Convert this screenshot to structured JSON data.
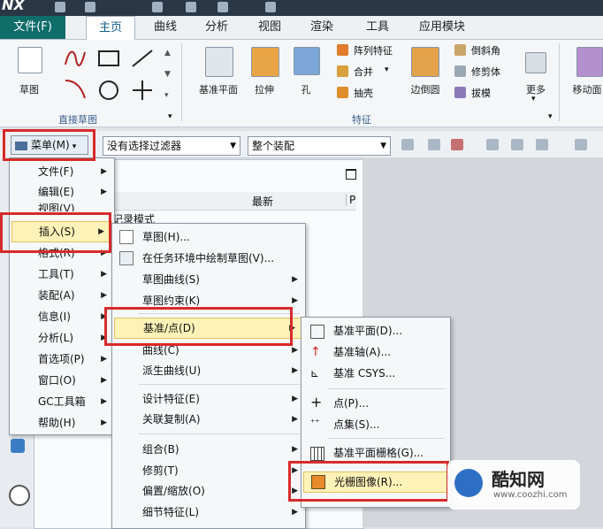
{
  "app": {
    "logo": "NX"
  },
  "tabs": [
    "文件(F)",
    "主页",
    "曲线",
    "分析",
    "视图",
    "渲染",
    "工具",
    "应用模块"
  ],
  "ribbon": {
    "sketch": "草图",
    "direct_sketch_group": "直接草图",
    "datum_plane": "基准平面",
    "extrude": "拉伸",
    "hole": "孔",
    "pattern_feature": "阵列特征",
    "unite": "合并",
    "shell": "抽壳",
    "edge_blend": "边倒圆",
    "chamfer": "倒斜角",
    "trim_body": "修剪体",
    "draft": "拔模",
    "more": "更多",
    "move_face": "移动面",
    "feature_group": "特征"
  },
  "toolbar": {
    "menu_button": "菜单(M)",
    "filter_value": "没有选择过滤器",
    "assembly_value": "整个装配"
  },
  "navigator": {
    "col_latest": "最新",
    "col_p": "P",
    "history_mode": "记录模式"
  },
  "main_menu": [
    "文件(F)",
    "编辑(E)",
    "视图(V)",
    "插入(S)",
    "格式(R)",
    "工具(T)",
    "装配(A)",
    "信息(I)",
    "分析(L)",
    "首选项(P)",
    "窗口(O)",
    "GC工具箱",
    "帮助(H)"
  ],
  "insert_menu": [
    "草图(H)...",
    "在任务环境中绘制草图(V)...",
    "草图曲线(S)",
    "草图约束(K)",
    "基准/点(D)",
    "曲线(C)",
    "派生曲线(U)",
    "设计特征(E)",
    "关联复制(A)",
    "组合(B)",
    "修剪(T)",
    "偏置/缩放(O)",
    "细节特征(L)"
  ],
  "datum_menu": [
    "基准平面(D)...",
    "基准轴(A)...",
    "基准 CSYS...",
    "点(P)...",
    "点集(S)...",
    "基准平面栅格(G)...",
    "光栅图像(R)..."
  ],
  "watermark": {
    "brand": "酷知网",
    "url": "www.coozhi.com"
  }
}
